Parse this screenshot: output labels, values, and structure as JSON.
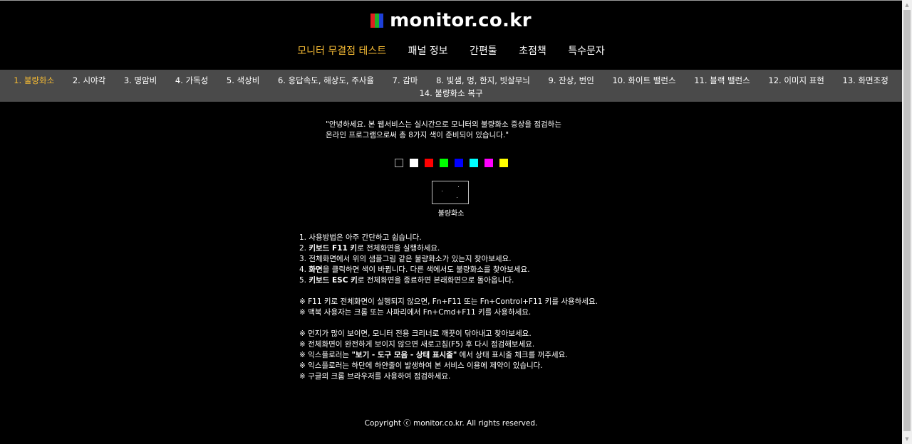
{
  "site": {
    "title": "monitor.co.kr"
  },
  "logo_colors": [
    "#e0201f",
    "#1fb02a",
    "#1d3fd8"
  ],
  "main_nav": [
    {
      "label": "모니터 무결점 테스트",
      "active": true
    },
    {
      "label": "패널 정보",
      "active": false
    },
    {
      "label": "간편툴",
      "active": false
    },
    {
      "label": "초점책",
      "active": false
    },
    {
      "label": "특수문자",
      "active": false
    }
  ],
  "sub_nav": [
    {
      "label": "1. 불량화소",
      "active": true
    },
    {
      "label": "2. 시야각"
    },
    {
      "label": "3. 명암비"
    },
    {
      "label": "4. 가독성"
    },
    {
      "label": "5. 색상비"
    },
    {
      "label": "6. 응답속도, 해상도, 주사율"
    },
    {
      "label": "7. 감마"
    },
    {
      "label": "8. 빛샘, 멍, 한지, 빗살무늬"
    },
    {
      "label": "9. 잔상, 번인"
    },
    {
      "label": "10. 화이트 밸런스"
    },
    {
      "label": "11. 블랙 밸런스"
    },
    {
      "label": "12. 이미지 표현"
    },
    {
      "label": "13. 화면조정"
    },
    {
      "label": "14. 불량화소 복구"
    }
  ],
  "intro": {
    "line1": "\"안녕하세요. 본 웹서비스는 실시간으로 모니터의 불량화소 증상을 점검하는",
    "line2": "온라인 프로그램으로써 총 8가지 색이 준비되어 있습니다.\""
  },
  "swatches": [
    "#000000",
    "#ffffff",
    "#ff0000",
    "#00ff00",
    "#0000ff",
    "#00ffff",
    "#ff00ff",
    "#ffff00"
  ],
  "sample": {
    "label": "불량화소"
  },
  "instructions": {
    "steps": [
      {
        "num": "1. ",
        "bold": "",
        "text": "사용방법은 아주 간단하고 쉽습니다."
      },
      {
        "num": "2. ",
        "bold": "키보드 F11 키",
        "text": "로 전체화면을 실행하세요."
      },
      {
        "num": "3. ",
        "bold": "",
        "text": "전체화면에서 위의 샘플그림 같은 불량화소가 있는지 찾아보세요."
      },
      {
        "num": "4. ",
        "bold": "화면",
        "text": "을 클릭하면 색이 바뀝니다. 다른 색에서도 불량화소를 찾아보세요."
      },
      {
        "num": "5. ",
        "bold": "키보드 ESC 키",
        "text": "로 전체화면을 종료하면 본래화면으로 돌아옵니다."
      }
    ],
    "notes_a": [
      "※ F11 키로 전체화면이 실행되지 않으면, Fn+F11 또는 Fn+Control+F11 키를 사용하세요.",
      "※ 맥북 사용자는 크롬 또는 사파리에서 Fn+Cmd+F11 키를 사용하세요."
    ],
    "notes_b": {
      "n1": "※ 먼지가 많이 보이면, 모니터 전용 크리너로 깨끗이 닦아내고 찾아보세요.",
      "n2": "※ 전체화면이 완전하게 보이지 않으면 새로고침(F5) 후 다시 점검해보세요.",
      "n3_pre": "※ 익스플로러는 ",
      "n3_bold": "\"보기 - 도구 모음 - 상태 표시줄\"",
      "n3_post": " 에서 상태 표시줄 체크를 꺼주세요.",
      "n4": "※ 익스플로러는 하단에 하얀줄이 발생하여 본 서비스 이용에 제약이 있습니다.",
      "n5": "※ 구글의 크롬 브라우저를 사용하여 점검하세요."
    }
  },
  "footer": {
    "text": "Copyright ⓒ monitor.co.kr. All rights reserved."
  }
}
